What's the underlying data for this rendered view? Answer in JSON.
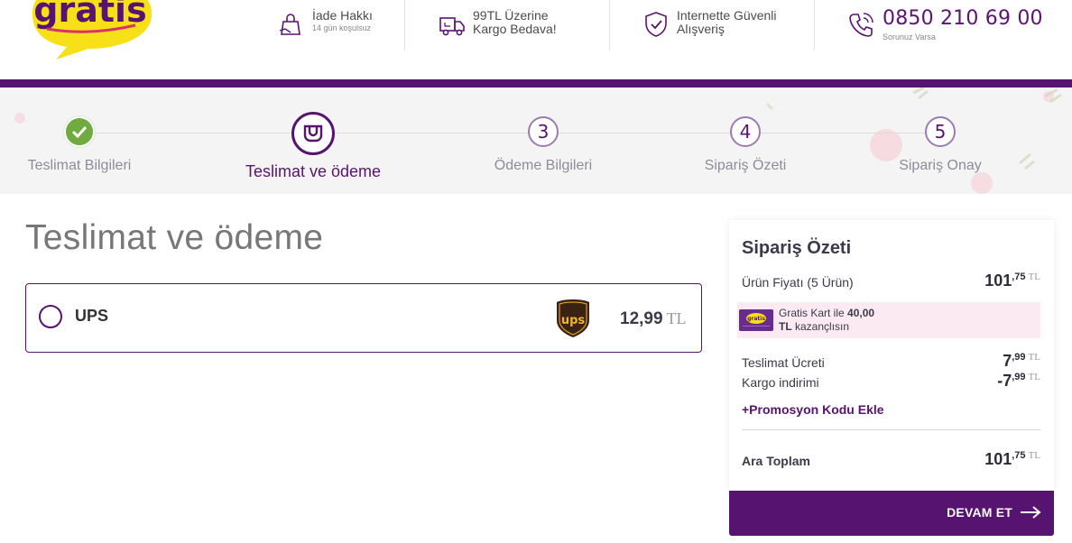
{
  "header": {
    "logo_text": "gratis",
    "info": [
      {
        "icon": "return-bag-icon",
        "title": "İade Hakkı",
        "subtitle": "14 gün koşulsuz"
      },
      {
        "icon": "delivery-truck-icon",
        "title": "99TL Üzerine",
        "subtitle": "Kargo Bedava!"
      },
      {
        "icon": "secure-shield-icon",
        "title": "Internette Güvenli",
        "subtitle": "Alışveriş"
      },
      {
        "icon": "phone-icon",
        "title": "0850 210 69 00",
        "subtitle": "Sorunuz Varsa"
      }
    ]
  },
  "steps": [
    {
      "label": "Teslimat Bilgileri",
      "state": "done",
      "number": ""
    },
    {
      "label": "Teslimat ve ödeme",
      "state": "active",
      "number": ""
    },
    {
      "label": "Ödeme Bilgileri",
      "state": "pending",
      "number": "3"
    },
    {
      "label": "Sipariş Özeti",
      "state": "pending",
      "number": "4"
    },
    {
      "label": "Sipariş Onay",
      "state": "pending",
      "number": "5"
    }
  ],
  "main": {
    "title": "Teslimat ve ödeme",
    "shipping_option": {
      "name": "UPS",
      "logo_text": "ups",
      "price": "12,99",
      "currency": "TL",
      "selected": false
    }
  },
  "summary": {
    "title": "Sipariş Özeti",
    "product_label": "Ürün Fiyatı (5 Ürün)",
    "product_amount": {
      "whole": "101",
      "decimal": ",75",
      "currency": "TL"
    },
    "gratis_card": {
      "mini_text": "gratis",
      "line1_prefix": "Gratis Kart ile ",
      "line1_bold": "40,00",
      "line2_bold": "TL",
      "line2_rest": " kazançlısın"
    },
    "delivery_label": "Teslimat Ücreti",
    "delivery_amount": {
      "whole": "7",
      "decimal": ",99",
      "currency": "TL"
    },
    "discount_label": "Kargo indirimi",
    "discount_amount": {
      "whole": "-7",
      "decimal": ",99",
      "currency": "TL"
    },
    "promo_label": "+Promosyon Kodu Ekle",
    "subtotal_label": "Ara Toplam",
    "subtotal_amount": {
      "whole": "101",
      "decimal": ",75",
      "currency": "TL"
    },
    "cta_label": "DEVAM ET"
  },
  "colors": {
    "brand_purple": "#571370",
    "logo_yellow": "#f7e017",
    "success_green": "#6fab3e",
    "card_pink": "#fbeaf2"
  }
}
